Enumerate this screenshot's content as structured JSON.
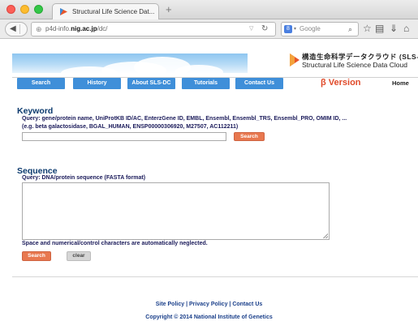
{
  "browser": {
    "tab_title": "Structural Life Science Dat...",
    "new_tab": "+",
    "url_prefix": "p4d-info.",
    "url_domain": "nig.ac.jp",
    "url_path": "/dc/",
    "search_placeholder": "Google",
    "search_engine_letter": "8"
  },
  "header": {
    "logo_jp": "構造生命科学データクラウド (SLS-DC)",
    "logo_en": "Structural Life Science Data Cloud"
  },
  "nav": {
    "items": [
      {
        "label": "Search"
      },
      {
        "label": "History"
      },
      {
        "label": "About SLS-DC"
      },
      {
        "label": "Tutorials"
      },
      {
        "label": "Contact Us"
      }
    ],
    "beta": "β Version",
    "home": "Home",
    "button_color": "#3f8fd9",
    "beta_color": "#e04a2a"
  },
  "keyword": {
    "heading": "Keyword",
    "query": "Query: gene/protein name, UniProtKB ID/AC, EnterzGene ID, EMBL, Ensembl, Ensembl_TRS, Ensembl_PRO, OMIM ID, ...",
    "example": "(e.g. beta galactosidase, BGAL_HUMAN, ENSP00000306920, M27507, AC112211)",
    "input_value": "",
    "search_label": "Search"
  },
  "sequence": {
    "heading": "Sequence",
    "query": "Query: DNA/protein sequence (FASTA format)",
    "textarea_value": "",
    "note": "Space and numerical/control characters are automatically neglected.",
    "search_label": "Search",
    "clear_label": "clear",
    "accent_color": "#e8784f"
  },
  "footer": {
    "site_policy": "Site Policy",
    "privacy_policy": "Privacy Policy",
    "contact_us": "Contact Us",
    "separator": " | ",
    "copyright": "Copyright © 2014 National Institute of Genetics"
  }
}
